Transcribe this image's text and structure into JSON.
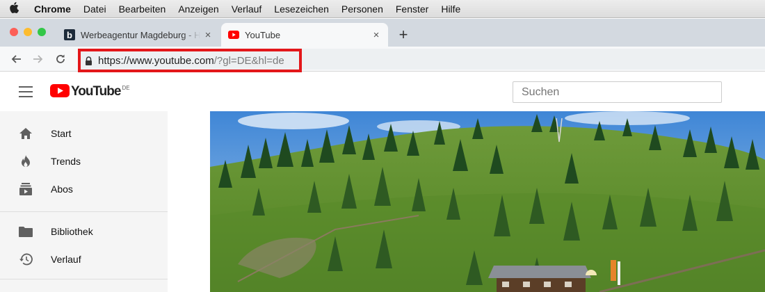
{
  "menubar": {
    "apple_icon": "apple-logo-icon",
    "app_name": "Chrome",
    "items": [
      "Datei",
      "Bearbeiten",
      "Anzeigen",
      "Verlauf",
      "Lesezeichen",
      "Personen",
      "Fenster",
      "Hilfe"
    ]
  },
  "window": {
    "traffic_lights": [
      "#fc5f57",
      "#fdbc2e",
      "#33c748"
    ]
  },
  "tabs": [
    {
      "title": "Werbeagentur Magdeburg - Homepage",
      "favicon": "b-letter-favicon-icon",
      "close": "×",
      "active": false
    },
    {
      "title": "YouTube",
      "favicon": "youtube-favicon-icon",
      "close": "×",
      "active": true
    }
  ],
  "toolbar": {
    "new_tab": "+",
    "url_host": "https://www.youtube.com",
    "url_rest": "/?gl=DE&hl=de",
    "highlight_color": "#e3171a"
  },
  "youtube": {
    "logo_text": "YouTube",
    "country_code": "DE",
    "brand_red": "#ff0000",
    "search_placeholder": "Suchen"
  },
  "sidebar": {
    "items": [
      {
        "label": "Start",
        "icon": "home-icon"
      },
      {
        "label": "Trends",
        "icon": "flame-icon"
      },
      {
        "label": "Abos",
        "icon": "subscriptions-icon"
      },
      {
        "label": "Bibliothek",
        "icon": "folder-icon"
      },
      {
        "label": "Verlauf",
        "icon": "history-icon"
      }
    ]
  }
}
